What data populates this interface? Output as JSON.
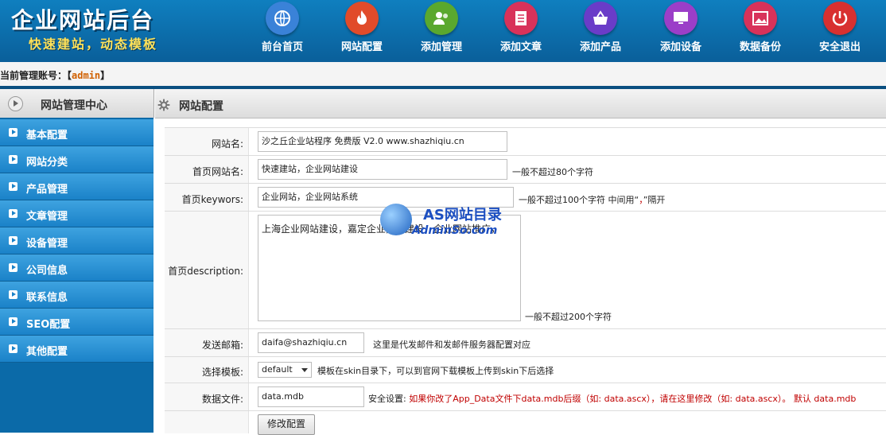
{
  "header": {
    "logo_title": "企业网站后台",
    "logo_subtitle": "快速建站，动态模板",
    "nav": [
      {
        "label": "前台首页",
        "icon": "globe-icon",
        "color": "#3a82d8"
      },
      {
        "label": "网站配置",
        "icon": "flame-icon",
        "color": "#e14b2a"
      },
      {
        "label": "添加管理",
        "icon": "users-icon",
        "color": "#5aa82e"
      },
      {
        "label": "添加文章",
        "icon": "document-list-icon",
        "color": "#d8325a"
      },
      {
        "label": "添加产品",
        "icon": "basket-icon",
        "color": "#6a3cc8"
      },
      {
        "label": "添加设备",
        "icon": "monitor-icon",
        "color": "#9b3ec8"
      },
      {
        "label": "数据备份",
        "icon": "picture-icon",
        "color": "#d8325a"
      },
      {
        "label": "安全退出",
        "icon": "power-icon",
        "color": "#d83030"
      }
    ]
  },
  "account": {
    "prefix": "当前管理账号：【",
    "username": "admin",
    "suffix": "】"
  },
  "sidebar": {
    "title": "网站管理中心",
    "items": [
      {
        "label": "基本配置"
      },
      {
        "label": "网站分类"
      },
      {
        "label": "产品管理"
      },
      {
        "label": "文章管理"
      },
      {
        "label": "设备管理"
      },
      {
        "label": "公司信息"
      },
      {
        "label": "联系信息"
      },
      {
        "label": "SEO配置"
      },
      {
        "label": "其他配置"
      }
    ]
  },
  "main": {
    "title": "网站配置",
    "form": {
      "site_name_label": "网站名:",
      "site_name_value": "沙之丘企业站程序 免费版 V2.0 www.shazhiqiu.cn",
      "home_name_label": "首页网站名:",
      "home_name_value": "快速建站，企业网站建设",
      "home_name_hint": "一般不超过80个字符",
      "keywords_label": "首页keywors:",
      "keywords_value": "企业网站，企业网站系统",
      "keywords_hint_a": "一般不超过100个字符 中间用“",
      "keywords_hint_sep": "，",
      "keywords_hint_b": "”隔开",
      "description_label": "首页description:",
      "description_value": "上海企业网站建设，嘉定企业网站建设，企业网站推广，",
      "description_hint": "一般不超过200个字符",
      "email_label": "发送邮箱:",
      "email_value": "daifa@shazhiqiu.cn",
      "email_hint": "这里是代发邮件和发邮件服务器配置对应",
      "template_label": "选择模板:",
      "template_value": "default",
      "template_hint": "模板在skin目录下，可以到官网下载模板上传到skin下后选择",
      "datafile_label": "数据文件:",
      "datafile_value": "data.mdb",
      "datafile_hint_a": "安全设置:",
      "datafile_hint_b": "如果你改了App_Data文件下data.mdb后缀（如: data.ascx），请在这里修改（如: data.ascx）。 默认 data.mdb",
      "submit_label": "修改配置"
    }
  },
  "watermark": {
    "line1": "AS网站目录",
    "line2": "AdminSo.com"
  }
}
